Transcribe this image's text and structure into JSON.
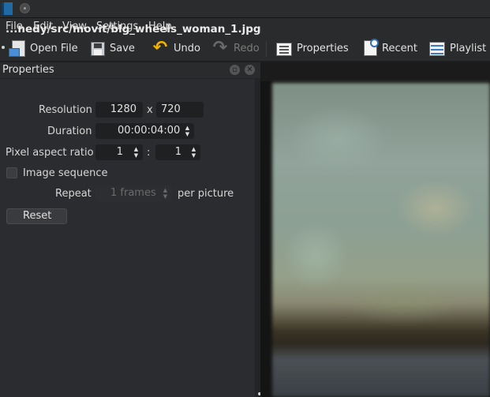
{
  "menubar": {
    "items": [
      {
        "label": "File"
      },
      {
        "label": "Edit"
      },
      {
        "label": "View"
      },
      {
        "label": "Settings"
      },
      {
        "label": "Help"
      }
    ]
  },
  "toolbar": {
    "open_file": {
      "label": "Open File",
      "icon": "open-file-icon"
    },
    "save": {
      "label": "Save",
      "icon": "save-icon"
    },
    "undo": {
      "label": "Undo",
      "icon": "undo-icon"
    },
    "redo": {
      "label": "Redo",
      "icon": "redo-icon",
      "enabled": false
    },
    "properties": {
      "label": "Properties",
      "icon": "properties-icon"
    },
    "recent": {
      "label": "Recent",
      "icon": "recent-icon"
    },
    "playlist": {
      "label": "Playlist",
      "icon": "playlist-icon"
    }
  },
  "properties_panel": {
    "title": "Properties",
    "filename": "...nedy/src/movit/blg_wheels_woman_1.jpg",
    "resolution": {
      "label": "Resolution",
      "width": "1280",
      "separator": "x",
      "height": "720"
    },
    "duration": {
      "label": "Duration",
      "value": "00:00:04:00"
    },
    "pixel_aspect_ratio": {
      "label": "Pixel aspect ratio",
      "num": "1",
      "separator": ":",
      "den": "1"
    },
    "image_sequence": {
      "label": "Image sequence",
      "checked": false
    },
    "repeat": {
      "label": "Repeat",
      "value": "1 frames",
      "suffix": "per picture",
      "enabled": false
    },
    "reset_label": "Reset"
  },
  "colors": {
    "background": "#2b2c2f",
    "titlebar": "#2a2b2d",
    "accent_undo": "#f0b400"
  }
}
